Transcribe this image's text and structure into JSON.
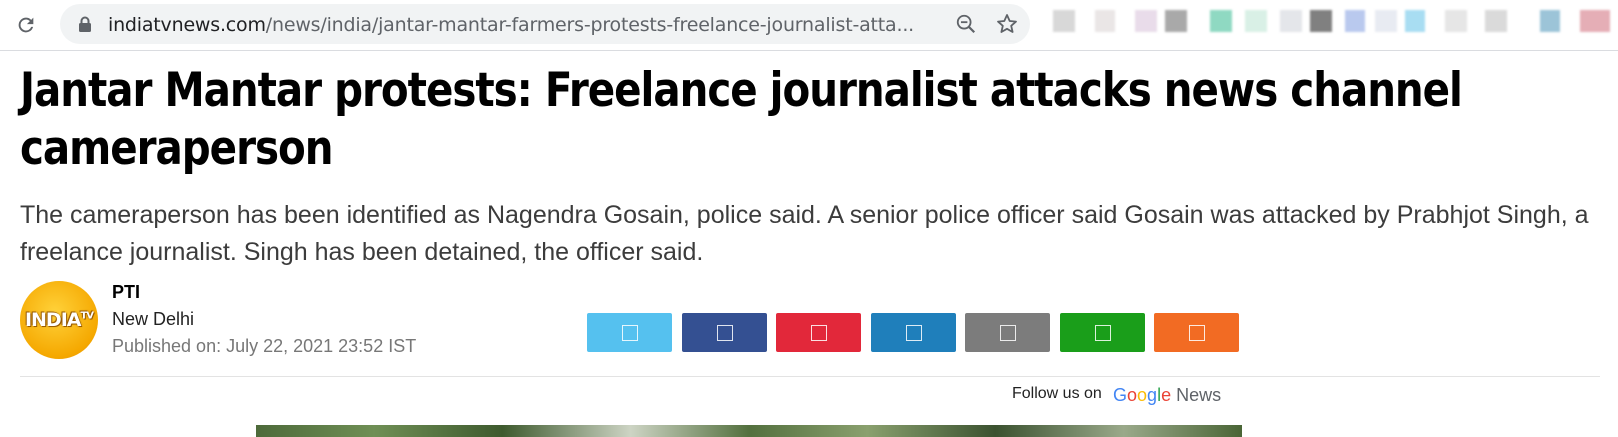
{
  "browser": {
    "url_domain": "indiatvnews.com",
    "url_path": "/news/india/jantar-mantar-farmers-protests-freelance-journalist-atta..."
  },
  "article": {
    "headline": "Jantar Mantar protests: Freelance journalist attacks news channel cameraperson",
    "summary": "The cameraperson has been identified as Nagendra Gosain, police said. A senior police officer said Gosain was attacked by Prabhjot Singh, a freelance journalist. Singh has been detained, the officer said.",
    "logo_text": "INDIA",
    "logo_tv": "TV",
    "author": "PTI",
    "location": "New Delhi",
    "published": "Published on: July 22, 2021 23:52 IST"
  },
  "share_buttons": [
    {
      "icon": "twitter-icon",
      "color": "#55c1ef"
    },
    {
      "icon": "facebook-icon",
      "color": "#345092"
    },
    {
      "icon": "pinterest-icon",
      "color": "#e2283a"
    },
    {
      "icon": "linkedin-icon",
      "color": "#1f7fbb"
    },
    {
      "icon": "email-icon",
      "color": "#7c7c7c"
    },
    {
      "icon": "whatsapp-icon",
      "color": "#1a9e1a"
    },
    {
      "icon": "share-icon",
      "color": "#f26b23"
    }
  ],
  "follow": {
    "label": "Follow us on",
    "google": "Google",
    "news": "News"
  },
  "colors": {
    "google_blue": "#4285f4",
    "google_red": "#ea4335",
    "google_yellow": "#fbbc05",
    "google_green": "#34a853"
  }
}
